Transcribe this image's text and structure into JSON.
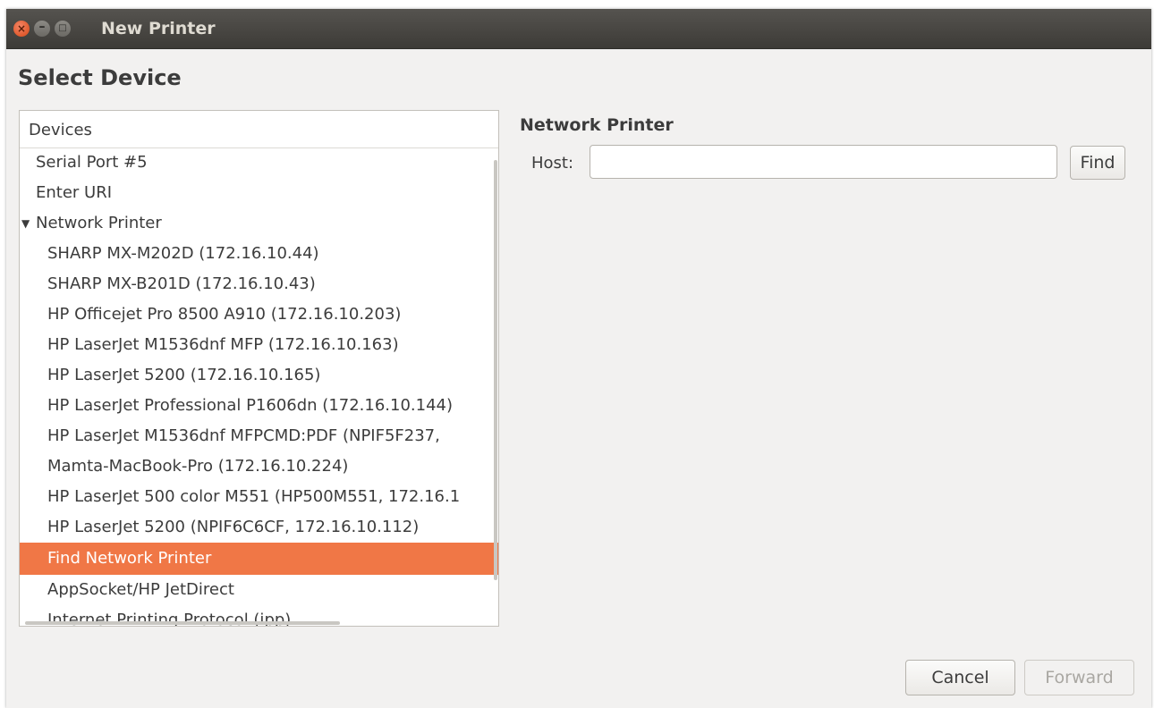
{
  "window": {
    "title": "New Printer",
    "close_glyph": "×",
    "minimize_glyph": "–",
    "maximize_glyph": "□"
  },
  "page": {
    "heading": "Select Device"
  },
  "devices": {
    "column_header": "Devices",
    "items": [
      {
        "label": "Serial Port #5"
      },
      {
        "label": "Enter URI"
      },
      {
        "label": "Network Printer",
        "expander": "▼"
      },
      {
        "label": "SHARP MX-M202D (172.16.10.44)"
      },
      {
        "label": "SHARP MX-B201D (172.16.10.43)"
      },
      {
        "label": "HP Officejet Pro 8500 A910 (172.16.10.203)"
      },
      {
        "label": "HP LaserJet M1536dnf MFP (172.16.10.163)"
      },
      {
        "label": "HP LaserJet 5200 (172.16.10.165)"
      },
      {
        "label": "HP LaserJet Professional P1606dn (172.16.10.144)"
      },
      {
        "label": "HP LaserJet M1536dnf MFPCMD:PDF (NPIF5F237,"
      },
      {
        "label": "Mamta-MacBook-Pro (172.16.10.224)"
      },
      {
        "label": "HP LaserJet 500 color M551 (HP500M551, 172.16.1"
      },
      {
        "label": "HP LaserJet 5200 (NPIF6C6CF, 172.16.10.112)"
      },
      {
        "label": "Find Network Printer",
        "selected": true
      },
      {
        "label": "AppSocket/HP JetDirect"
      },
      {
        "label": "Internet Printing Protocol (ipp)"
      }
    ]
  },
  "network_printer": {
    "title": "Network Printer",
    "host_label": "Host:",
    "host_value": "",
    "find_label": "Find"
  },
  "footer": {
    "cancel_label": "Cancel",
    "forward_label": "Forward"
  },
  "colors": {
    "selection": "#f07746",
    "titlebar": "#3d3b37",
    "window_bg": "#f2f1f0"
  }
}
